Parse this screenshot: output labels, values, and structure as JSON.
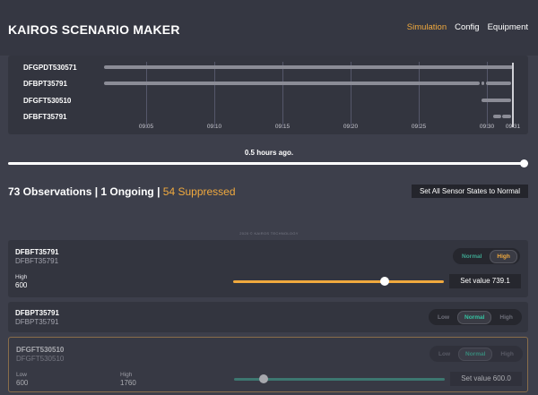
{
  "header": {
    "title": "KAIROS SCENARIO MAKER",
    "nav": [
      "Simulation",
      "Config",
      "Equipment"
    ],
    "active_tab": "Simulation"
  },
  "timeline": {
    "rows": [
      "DFGPDT530571",
      "DFBPT35791",
      "DFGFT530510",
      "DFBFT35791"
    ],
    "ticks": [
      "09:05",
      "09:10",
      "09:15",
      "09:20",
      "09:25",
      "09:30",
      "09:31"
    ]
  },
  "time_range": {
    "label": "0.5 hours ago.",
    "position_percent": 100
  },
  "summary": {
    "observations": "73 Observations",
    "ongoing": "1 Ongoing",
    "suppressed": "54 Suppressed",
    "separator": "|"
  },
  "actions": {
    "reset_label": "Set All Sensor States to Normal"
  },
  "copyright": "2020 © KAIROS TECHNOLOGY",
  "sensors": [
    {
      "name": "DFBFT35791",
      "subtitle": "DFBFT35791",
      "states": [
        "Normal",
        "High"
      ],
      "selected": "High",
      "threshold_label": "High",
      "threshold_value": "600",
      "set_value": "Set value 739.1",
      "slider_percent": 72,
      "color": "#f0a93e"
    },
    {
      "name": "DFBPT35791",
      "subtitle": "DFBPT35791",
      "states": [
        "Low",
        "Normal",
        "High"
      ],
      "selected": "Normal"
    },
    {
      "name": "DFGFT530510",
      "subtitle": "DFGFT530510",
      "states": [
        "Low",
        "Normal",
        "High"
      ],
      "selected": "Normal",
      "low_label": "Low",
      "low_value": "600",
      "high_label": "High",
      "high_value": "1760",
      "set_value": "Set value 600.0",
      "slider_percent": 14,
      "color": "#3ea58f"
    }
  ]
}
